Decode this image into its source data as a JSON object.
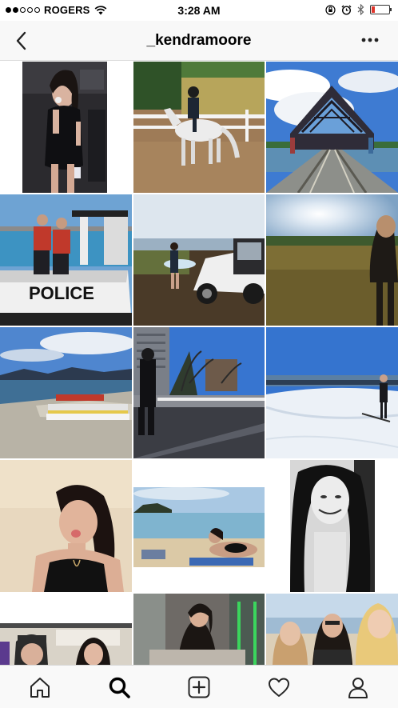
{
  "status_bar": {
    "carrier": "ROGERS",
    "time": "3:28 AM",
    "signal_bars_filled": 2,
    "signal_bars_total": 5,
    "battery_level": 0.2,
    "icons": [
      "wifi-icon",
      "orientation-lock-icon",
      "alarm-icon",
      "bluetooth-icon",
      "battery-icon"
    ]
  },
  "nav": {
    "title": "_kendramoore",
    "back_icon": "chevron-left-icon",
    "more_icon": "more-horizontal-icon"
  },
  "grid": {
    "posts": [
      {
        "name": "photo-selfie-black-dress",
        "scene": "night-selfie"
      },
      {
        "name": "photo-horse-rider",
        "scene": "horse"
      },
      {
        "name": "photo-railway-bridge",
        "scene": "bridge"
      },
      {
        "name": "photo-police-boat",
        "scene": "police-boat"
      },
      {
        "name": "photo-jeep-paddleboard",
        "scene": "jeep"
      },
      {
        "name": "photo-sunset-field",
        "scene": "field"
      },
      {
        "name": "photo-rocky-beach",
        "scene": "beach"
      },
      {
        "name": "photo-city-walkway",
        "scene": "city"
      },
      {
        "name": "photo-snow-field",
        "scene": "snow"
      },
      {
        "name": "photo-tongue-out-portrait",
        "scene": "portrait"
      },
      {
        "name": "photo-lying-on-beach",
        "scene": "sand"
      },
      {
        "name": "photo-black-white-selfie",
        "scene": "bw"
      },
      {
        "name": "photo-couple-selfie",
        "scene": "couple"
      },
      {
        "name": "photo-cafe-sitting",
        "scene": "cafe"
      },
      {
        "name": "photo-three-friends",
        "scene": "friends"
      }
    ],
    "police_text": "POLICE"
  },
  "tab_bar": {
    "tabs": [
      {
        "name": "home-icon",
        "active": false
      },
      {
        "name": "search-icon",
        "active": true
      },
      {
        "name": "add-post-icon",
        "active": false
      },
      {
        "name": "heart-icon",
        "active": false
      },
      {
        "name": "profile-icon",
        "active": false
      }
    ]
  },
  "colors": {
    "nav_background": "#f8f8f8",
    "tab_background": "#f9f9f9",
    "battery_fill": "#e0352b",
    "divider": "#dbdbdb"
  }
}
